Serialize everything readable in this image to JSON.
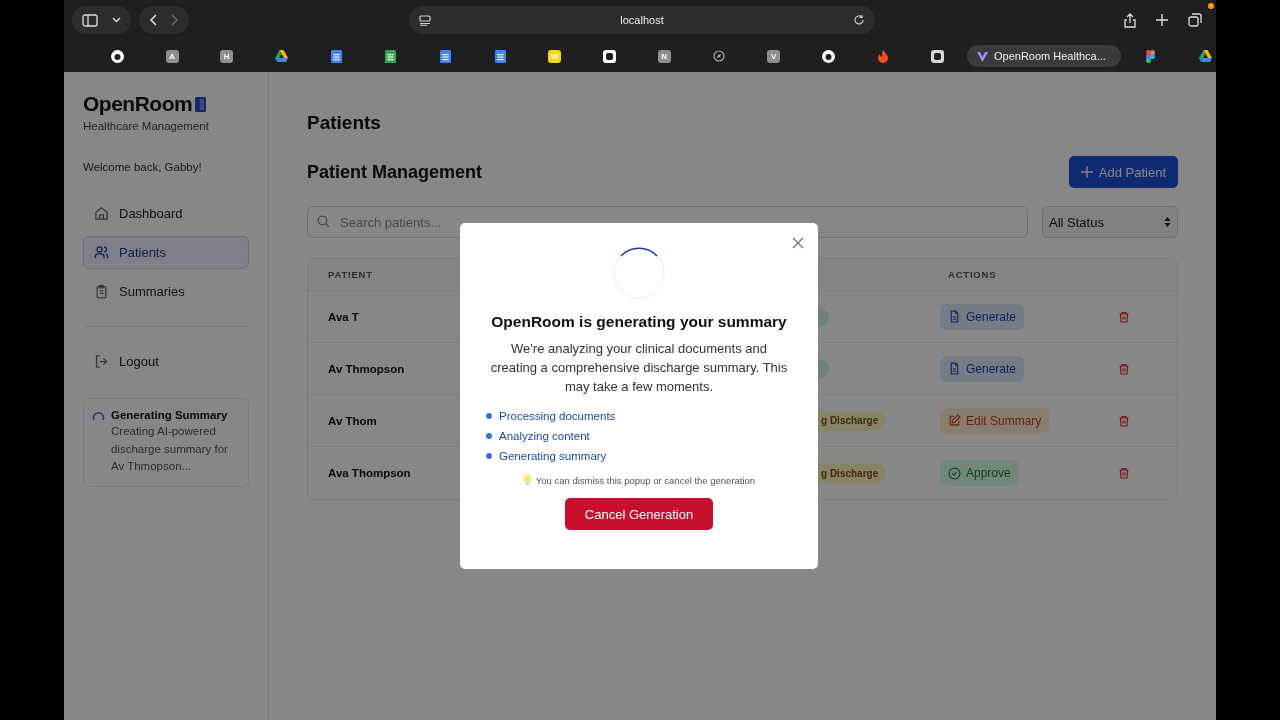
{
  "browser": {
    "address": "localhost",
    "bookmarks": [
      {
        "kind": "github"
      },
      {
        "kind": "letter",
        "letter": "A",
        "color": "#8e8e93"
      },
      {
        "kind": "letter",
        "letter": "H",
        "color": "#8e8e93"
      },
      {
        "kind": "drive"
      },
      {
        "kind": "doc",
        "color": "#4285f4"
      },
      {
        "kind": "doc",
        "color": "#34a853"
      },
      {
        "kind": "doc",
        "color": "#4285f4"
      },
      {
        "kind": "doc",
        "color": "#4285f4"
      },
      {
        "kind": "letter",
        "letter": "W",
        "color": "#f5d90a"
      },
      {
        "kind": "square",
        "color": "#ffffff"
      },
      {
        "kind": "letter",
        "letter": "N",
        "color": "#8e8e93"
      },
      {
        "kind": "compass"
      },
      {
        "kind": "letter",
        "letter": "V",
        "color": "#8e8e93"
      },
      {
        "kind": "github"
      },
      {
        "kind": "flame"
      },
      {
        "kind": "square",
        "color": "#d8d8d8"
      },
      {
        "kind": "tab",
        "label": "OpenRoom Healthca..."
      },
      {
        "kind": "figma"
      },
      {
        "kind": "drive"
      }
    ]
  },
  "sidebar": {
    "brand": "OpenRoom",
    "subtitle": "Healthcare Management",
    "welcome": "Welcome back, Gabby!",
    "items": [
      {
        "kind": "home",
        "label": "Dashboard",
        "selected": false
      },
      {
        "kind": "people",
        "label": "Patients",
        "selected": true
      },
      {
        "kind": "clipboard",
        "label": "Summaries",
        "selected": false
      }
    ],
    "logout": "Logout",
    "job": {
      "title": "Generating Summary",
      "text": "Creating AI-powered discharge summary for Av Thmopson..."
    }
  },
  "main": {
    "title": "Patients",
    "section": "Patient Management",
    "add_button": "Add Patient",
    "search": {
      "placeholder": "Search patients..."
    },
    "filter": "All Status",
    "table": {
      "columns": [
        "PATIENT",
        "ACTIONS"
      ],
      "rows": [
        {
          "name": "Ava T",
          "status": {
            "kind": "green"
          },
          "action": {
            "kind": "generate",
            "label": "Generate"
          }
        },
        {
          "name": "Av Thmopson",
          "status": {
            "kind": "green"
          },
          "action": {
            "kind": "generate",
            "label": "Generate"
          }
        },
        {
          "name": "Av Thom",
          "status": {
            "kind": "yellow",
            "text": "g Discharge"
          },
          "action": {
            "kind": "edit",
            "label": "Edit Summary"
          }
        },
        {
          "name": "Ava Thompson",
          "status": {
            "kind": "yellow",
            "text": "g Discharge"
          },
          "action": {
            "kind": "approve",
            "label": "Approve"
          }
        }
      ]
    }
  },
  "modal": {
    "title": "OpenRoom is generating your summary",
    "text": "We're analyzing your clinical documents and creating a comprehensive discharge summary. This may take a few moments.",
    "steps": [
      "Processing documents",
      "Analyzing content",
      "Generating summary"
    ],
    "hint": "You can dismiss this popup or cancel the generation",
    "cancel": "Cancel Generation"
  }
}
